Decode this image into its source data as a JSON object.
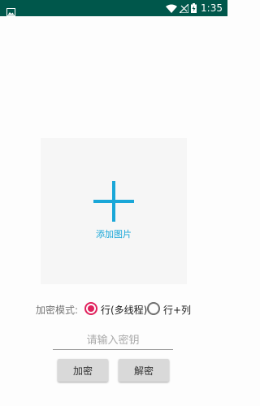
{
  "status_bar": {
    "time": "1:35",
    "background": "#00574b",
    "icons": [
      "gallery-icon",
      "wifi-icon",
      "no-signal-icon",
      "battery-charging-icon"
    ]
  },
  "image_picker": {
    "label": "添加图片",
    "icon": "plus-icon",
    "accent": "#1aa7d8"
  },
  "encrypt_mode": {
    "label": "加密模式:",
    "options": [
      {
        "label": "行(多线程)",
        "selected": true
      },
      {
        "label": "行+列",
        "selected": false
      }
    ],
    "selected_color": "#e0225d"
  },
  "key_input": {
    "placeholder": "请输入密钥",
    "value": ""
  },
  "buttons": {
    "encrypt": "加密",
    "decrypt": "解密"
  }
}
